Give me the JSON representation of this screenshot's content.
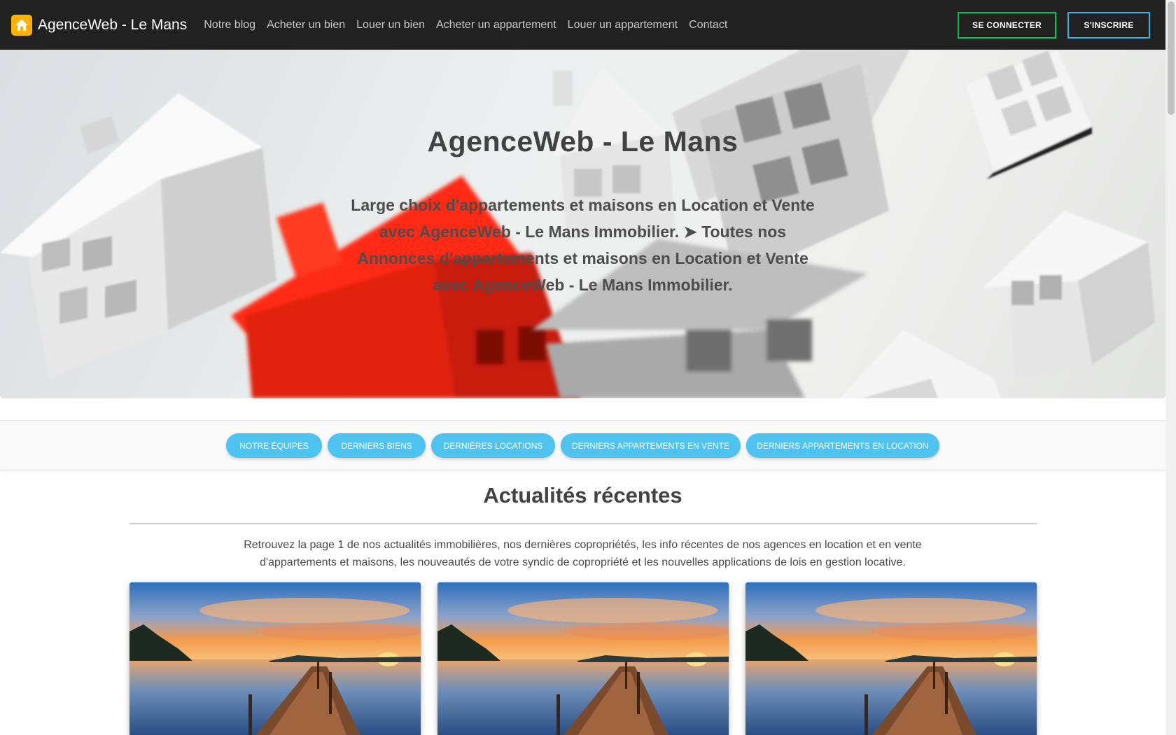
{
  "navbar": {
    "brand_name": "AgenceWeb - Le Mans",
    "links": [
      "Notre blog",
      "Acheter un bien",
      "Louer un bien",
      "Acheter un appartement",
      "Louer un appartement",
      "Contact"
    ],
    "login_label": "SE CONNECTER",
    "signup_label": "S'INSCRIRE"
  },
  "hero": {
    "title": "AgenceWeb - Le Mans",
    "subtitle": "Large choix d'appartements et maisons en Location et Vente avec AgenceWeb - Le Mans Immobilier. ➤ Toutes nos Annonces d'appartements et maisons en Location et Vente avec AgenceWeb - Le Mans Immobilier."
  },
  "tabs": [
    "NOTRE ÉQUIPES",
    "DERNIERS BIENS",
    "DERNIÈRES LOCATIONS",
    "DERNIERS APPARTEMENTS EN VENTE",
    "DERNIERS APPARTEMENTS EN LOCATION"
  ],
  "news": {
    "title": "Actualités récentes",
    "intro": "Retrouvez la page 1 de nos actualités immobilières, nos dernières copropriétés, les info récentes de nos agences en location et en vente d'appartements et maisons, les nouveautés de votre syndic de copropriété et les nouvelles applications de lois en gestion locative.",
    "card_count": 3
  },
  "colors": {
    "navbar_bg": "#212121",
    "brand_logo": "#ffb300",
    "login_border": "#00c851",
    "signup_border": "#33b5e5",
    "tab_bg": "#4fc3f0"
  },
  "icons": [
    "home-icon"
  ]
}
